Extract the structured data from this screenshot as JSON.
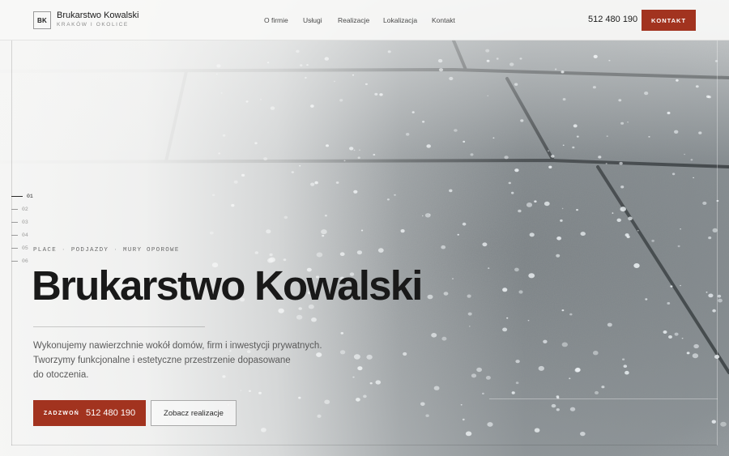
{
  "header": {
    "logo_mark": "BK",
    "brand_name": "Brukarstwo Kowalski",
    "brand_sub": "KRAKÓW I OKOLICE",
    "nav": [
      "O firmie",
      "Usługi",
      "Realizacje",
      "Lokalizacja",
      "Kontakt"
    ],
    "phone": "512 480 190",
    "contact_label": "KONTAKT"
  },
  "slider": {
    "items": [
      "01",
      "02",
      "03",
      "04",
      "05",
      "06"
    ],
    "active_index": 0
  },
  "hero": {
    "tags": [
      "PLACE",
      "PODJAZDY",
      "MURY OPOROWE"
    ],
    "title": "Brukarstwo Kowalski",
    "text_lines": [
      "Wykonujemy nawierzchnie wokół domów, firm i inwestycji prywatnych.",
      "Tworzymy funkcjonalne i estetyczne przestrzenie dopasowane",
      "do otoczenia."
    ],
    "call_label": "ZADZWOŃ",
    "call_number": "512 480 190",
    "works_label": "Zobacz realizacje"
  },
  "colors": {
    "accent": "#a2331f",
    "text": "#1d1d1d",
    "background": "#f4f4f2"
  }
}
